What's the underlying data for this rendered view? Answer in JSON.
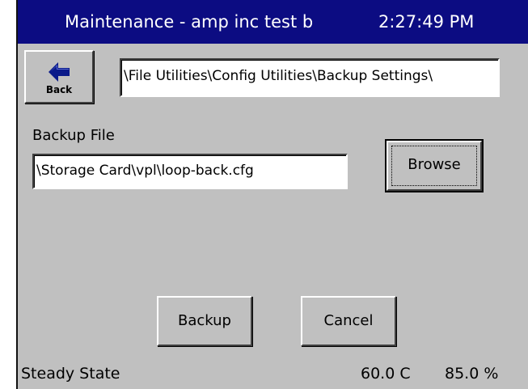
{
  "titlebar": {
    "title": "Maintenance - amp inc test b",
    "time": "2:27:49 PM"
  },
  "toolbar": {
    "back_label": "Back",
    "back_icon": "back-arrow-icon",
    "path": "\\File Utilities\\Config Utilities\\Backup Settings\\"
  },
  "backup": {
    "label": "Backup File",
    "file_value": "\\Storage Card\\vpl\\loop-back.cfg",
    "browse_label": "Browse"
  },
  "actions": {
    "backup_label": "Backup",
    "cancel_label": "Cancel"
  },
  "status": {
    "state": "Steady State",
    "temperature": "60.0 C",
    "humidity": "85.0 %"
  },
  "colors": {
    "titlebar_bg": "#0c0c82",
    "panel_bg": "#c0c0c0",
    "arrow_blue": "#0a1a8a"
  }
}
